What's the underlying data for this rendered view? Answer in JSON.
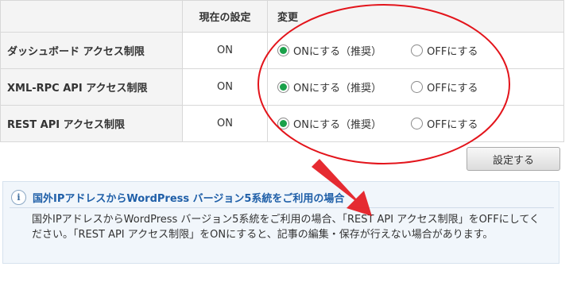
{
  "table": {
    "headers": {
      "current": "現在の設定",
      "change": "変更"
    },
    "rows": [
      {
        "label": "ダッシュボード アクセス制限",
        "current": "ON",
        "option_on": "ONにする（推奨）",
        "option_off": "OFFにする",
        "selected": "on"
      },
      {
        "label": "XML-RPC API アクセス制限",
        "current": "ON",
        "option_on": "ONにする（推奨）",
        "option_off": "OFFにする",
        "selected": "on"
      },
      {
        "label": "REST API アクセス制限",
        "current": "ON",
        "option_on": "ONにする（推奨）",
        "option_off": "OFFにする",
        "selected": "on"
      }
    ]
  },
  "save_button": "設定する",
  "notice": {
    "title": "国外IPアドレスからWordPress バージョン5系統をご利用の場合",
    "body": "国外IPアドレスからWordPress バージョン5系統をご利用の場合、「REST API アクセス制限」をOFFにしてください。「REST API アクセス制限」をONにすると、記事の編集・保存が行えない場合があります。"
  },
  "annotation_colors": {
    "ellipse": "#e3141b",
    "arrow": "#e3141b"
  },
  "radio_checked_color": "#1aa14a"
}
